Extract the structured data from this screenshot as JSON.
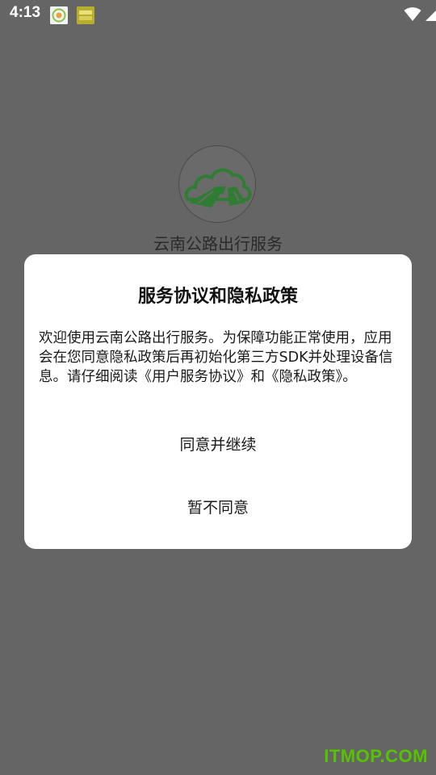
{
  "status_bar": {
    "time": "4:13"
  },
  "splash": {
    "app_name": "云南公路出行服务"
  },
  "dialog": {
    "title": "服务协议和隐私政策",
    "body": "欢迎使用云南公路出行服务。为保障功能正常使用，应用会在您同意隐私政策后再初始化第三方SDK并处理设备信息。请仔细阅读《用户服务协议》和《隐私政策》。",
    "agree_label": "同意并继续",
    "disagree_label": "暂不同意"
  },
  "watermark": "ITMOP.COM",
  "colors": {
    "overlay_bg": "#656565",
    "dialog_bg": "#ffffff",
    "logo_green": "#2e7d32",
    "watermark_green": "#55c400"
  }
}
